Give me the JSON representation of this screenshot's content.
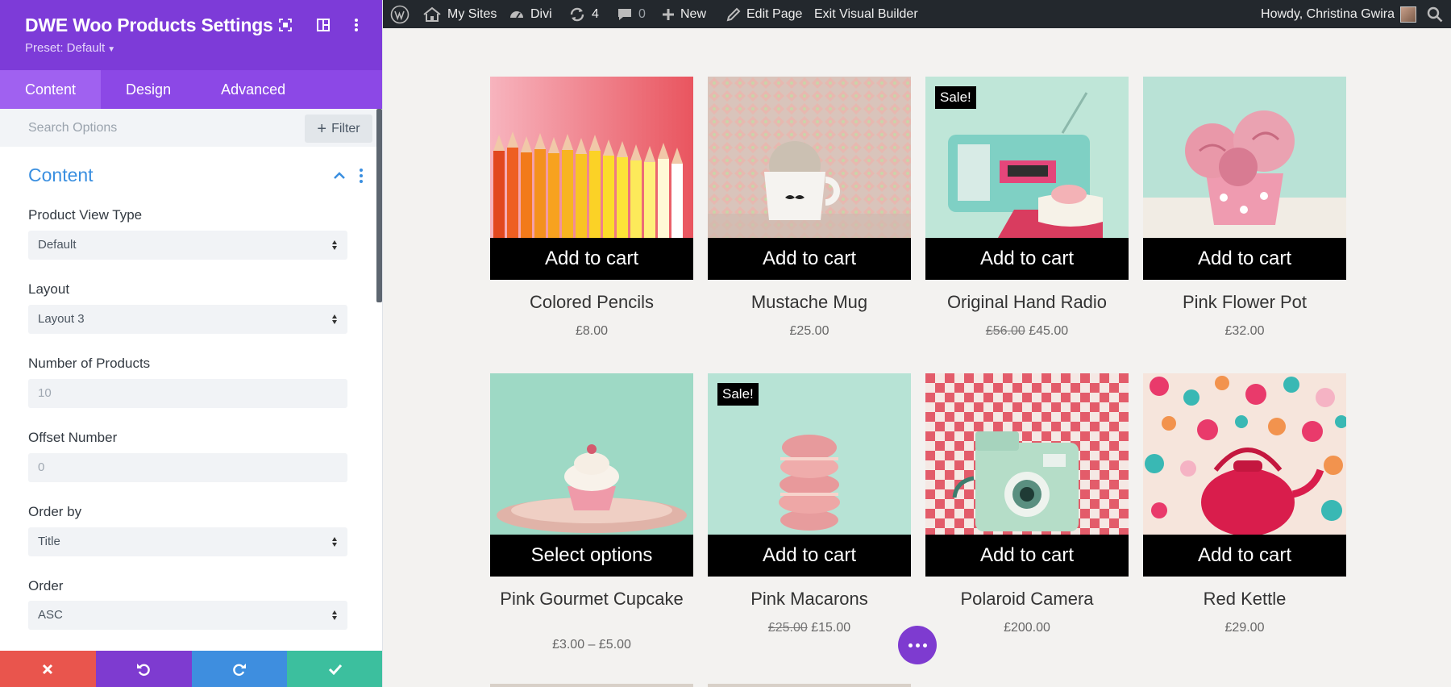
{
  "panel": {
    "title": "DWE Woo Products Settings",
    "preset": "Preset: Default",
    "tabs": [
      "Content",
      "Design",
      "Advanced"
    ],
    "search_placeholder": "Search Options",
    "filter_label": "Filter",
    "section_title": "Content",
    "fields": [
      {
        "label": "Product View Type",
        "value": "Default"
      },
      {
        "label": "Layout",
        "value": "Layout 3"
      },
      {
        "label": "Number of Products",
        "value": "10"
      },
      {
        "label": "Offset Number",
        "value": "0"
      },
      {
        "label": "Order by",
        "value": "Title"
      },
      {
        "label": "Order",
        "value": "ASC"
      }
    ],
    "bottom_colors": [
      "#e9554d",
      "#7e3bd0",
      "#3e8edf",
      "#3cbf9e"
    ]
  },
  "adminbar": {
    "my_sites": "My Sites",
    "divi": "Divi",
    "updates_count": "4",
    "comments_count": "0",
    "new": "New",
    "edit_page": "Edit Page",
    "exit_builder": "Exit Visual Builder",
    "howdy": "Howdy, Christina Gwira"
  },
  "products": [
    {
      "name": "Colored Pencils",
      "price": "£8.00",
      "old_price": "",
      "button": "Add to cart",
      "sale": ""
    },
    {
      "name": "Mustache Mug",
      "price": "£25.00",
      "old_price": "",
      "button": "Add to cart",
      "sale": ""
    },
    {
      "name": "Original Hand Radio",
      "price": "£45.00",
      "old_price": "£56.00",
      "button": "Add to cart",
      "sale": "Sale!"
    },
    {
      "name": "Pink Flower Pot",
      "price": "£32.00",
      "old_price": "",
      "button": "Add to cart",
      "sale": ""
    },
    {
      "name": "Pink Gourmet Cupcake",
      "price": "£3.00 – £5.00",
      "old_price": "",
      "button": "Select options",
      "sale": ""
    },
    {
      "name": "Pink Macarons",
      "price": "£15.00",
      "old_price": "£25.00",
      "button": "Add to cart",
      "sale": "Sale!"
    },
    {
      "name": "Polaroid Camera",
      "price": "£200.00",
      "old_price": "",
      "button": "Add to cart",
      "sale": ""
    },
    {
      "name": "Red Kettle",
      "price": "£29.00",
      "old_price": "",
      "button": "Add to cart",
      "sale": ""
    }
  ],
  "icons": {
    "wordpress": "wordpress-logo-icon",
    "my_sites": "my-sites-icon",
    "divi": "divi-dashboard-icon",
    "updates": "updates-icon",
    "comments": "comments-icon",
    "new": "plus-icon",
    "edit": "pencil-icon",
    "search": "search-icon",
    "fab": "more-dots-icon"
  }
}
